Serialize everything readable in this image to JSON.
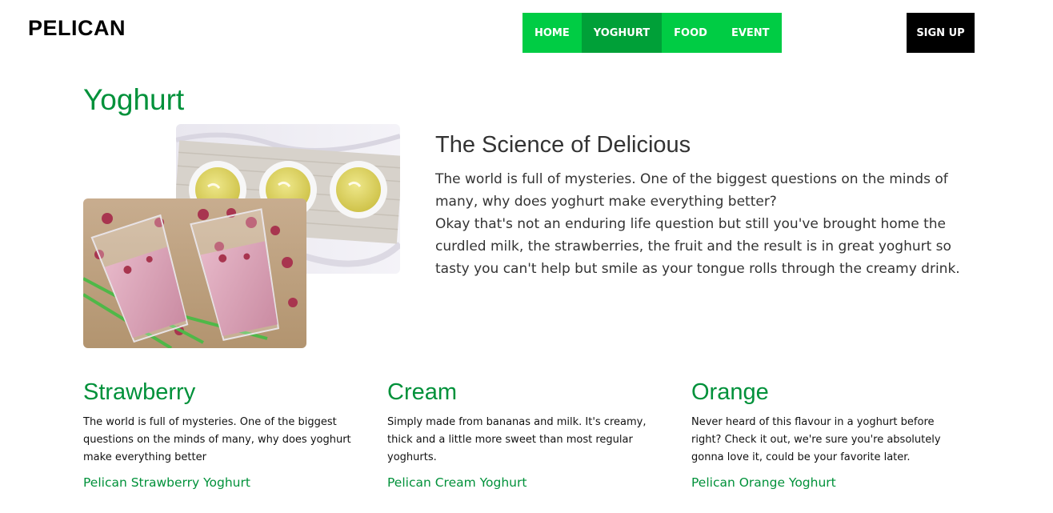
{
  "brand": {
    "name": "PELICAN"
  },
  "nav": {
    "items": [
      {
        "label": "HOME",
        "active": false
      },
      {
        "label": "YOGHURT",
        "active": true
      },
      {
        "label": "FOOD",
        "active": false
      },
      {
        "label": "EVENT",
        "active": false
      }
    ],
    "signup_label": "SIGN UP"
  },
  "colors": {
    "accent": "#00cc44",
    "accent_active": "#00a038",
    "heading_green": "#00913a"
  },
  "page": {
    "title": "Yoghurt"
  },
  "images": {
    "back": "photo-three-cups-of-yellow-yoghurt",
    "front": "photo-two-glasses-of-raspberry-smoothie"
  },
  "science": {
    "title": "The Science of Delicious",
    "paragraph1": "The world is full of mysteries. One of the biggest questions on the minds of many, why does yoghurt make everything better?",
    "paragraph2": "Okay that's not an enduring life question but still you've brought home the curdled milk, the strawberries, the fruit and the result is in great yoghurt so tasty you can't help but smile as your tongue rolls through the creamy drink."
  },
  "flavours": [
    {
      "title": "Strawberry",
      "text": "The world is full of mysteries. One of the biggest questions on the minds of many, why does yoghurt make everything better",
      "link": "Pelican Strawberry Yoghurt"
    },
    {
      "title": "Cream",
      "text": "Simply made from bananas and milk. It's creamy, thick and a little more sweet than most regular yoghurts.",
      "link": "Pelican Cream Yoghurt"
    },
    {
      "title": "Orange",
      "text": "Never heard of this flavour in a yoghurt before right? Check it out, we're sure you're absolutely gonna love it, could be your favorite later.",
      "link": "Pelican Orange Yoghurt"
    }
  ]
}
